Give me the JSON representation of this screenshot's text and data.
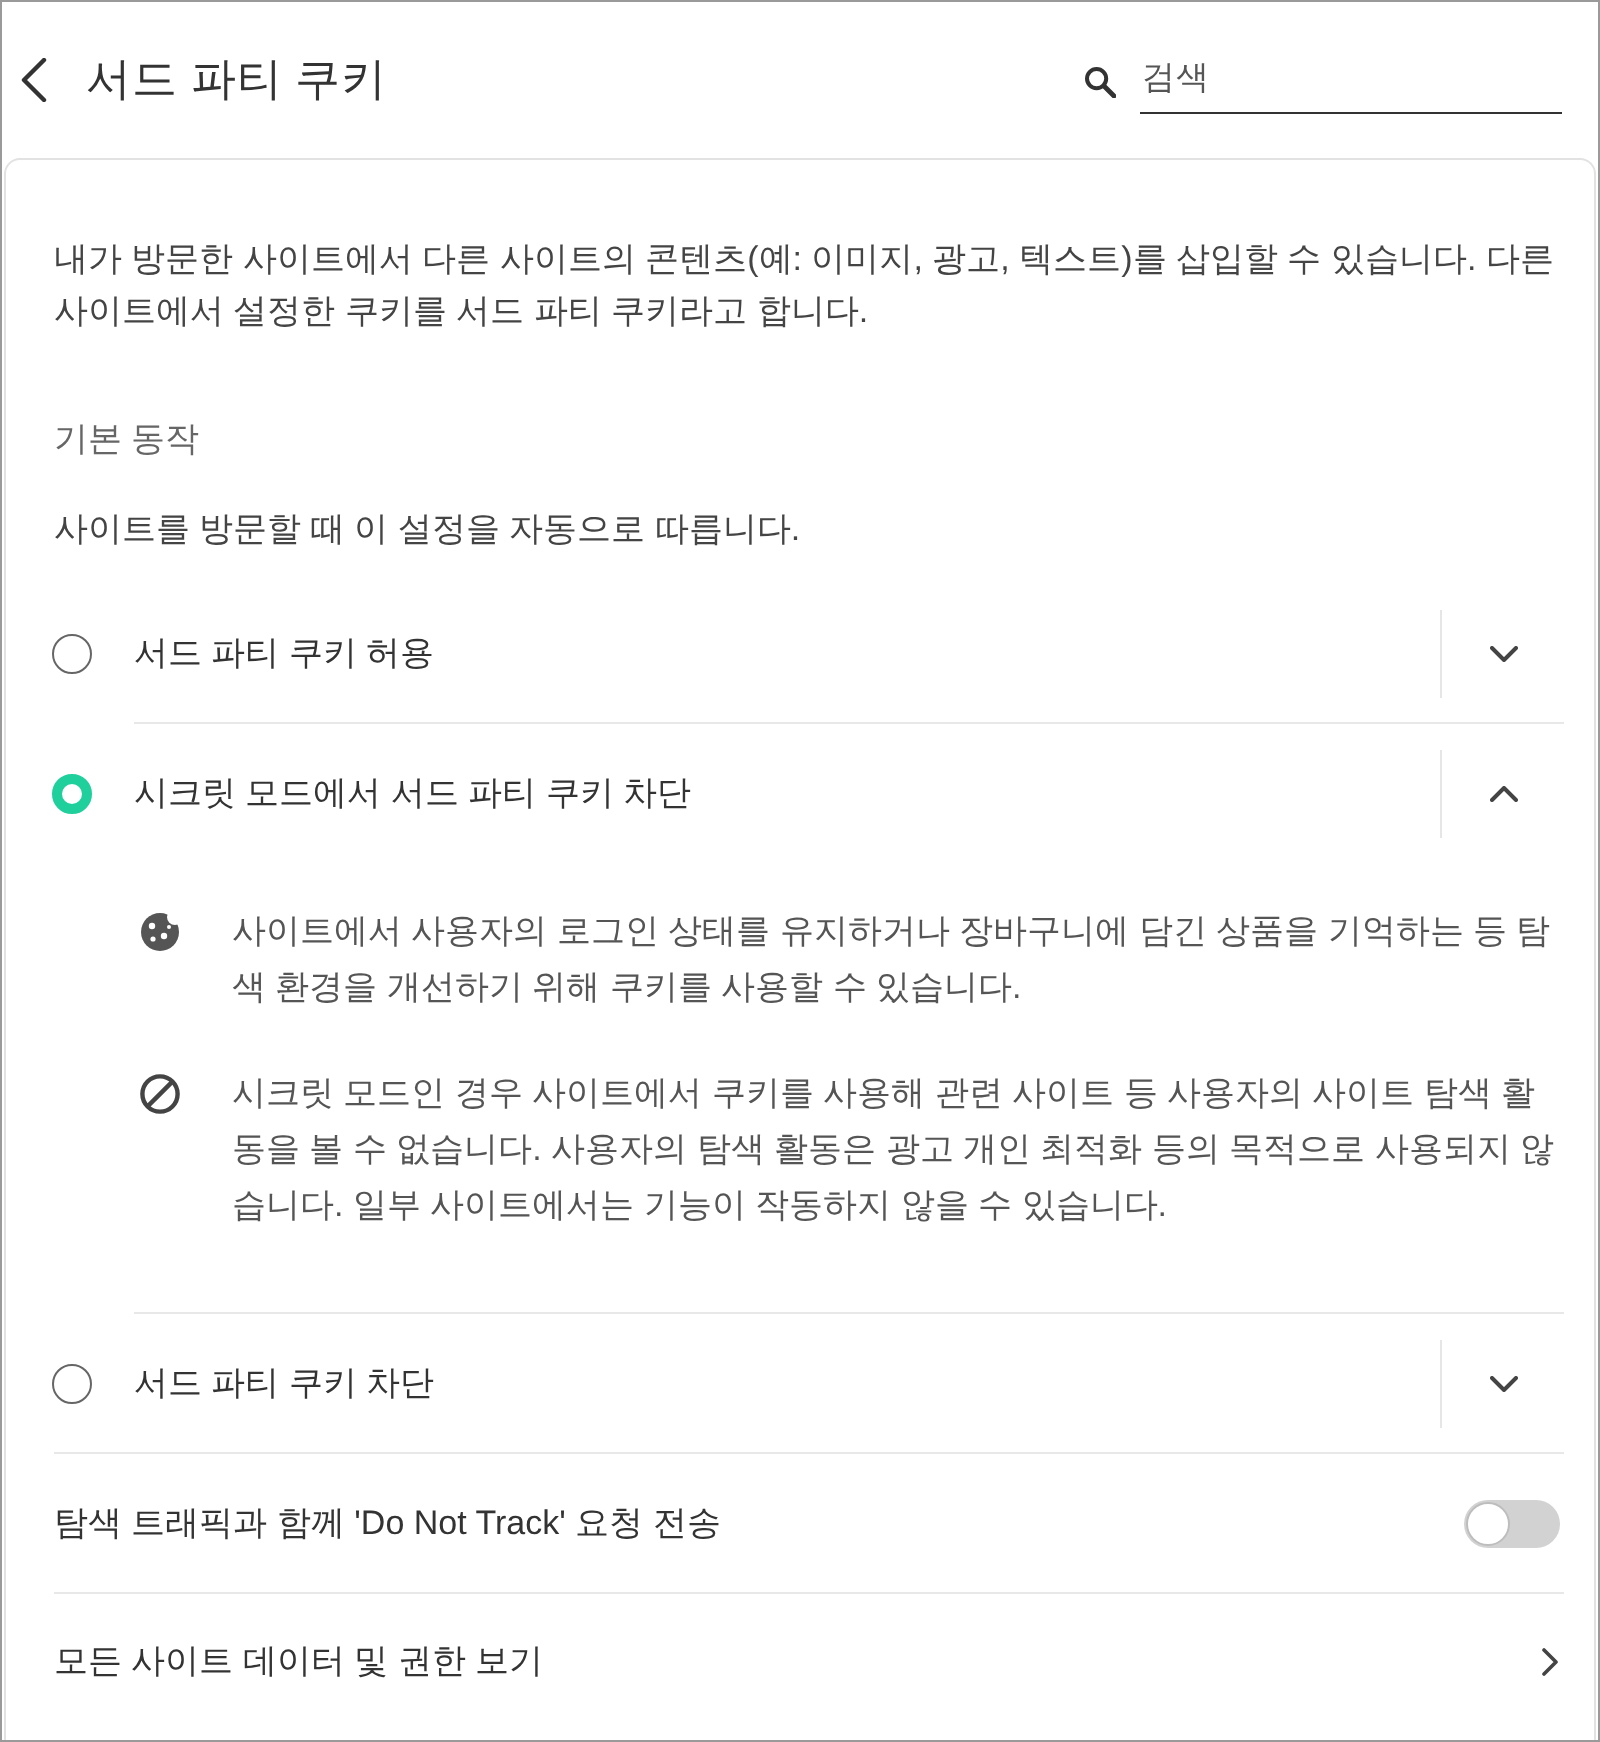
{
  "header": {
    "title": "서드 파티 쿠키",
    "search": {
      "placeholder": "검색"
    }
  },
  "intro": "내가 방문한 사이트에서 다른 사이트의 콘텐츠(예: 이미지, 광고, 텍스트)를 삽입할 수 있습니다. 다른 사이트에서 설정한 쿠키를 서드 파티 쿠키라고 합니다.",
  "default_behavior": {
    "heading": "기본 동작",
    "description": "사이트를 방문할 때 이 설정을 자동으로 따릅니다.",
    "options": [
      {
        "label": "서드 파티 쿠키 허용",
        "selected": false,
        "expanded": false
      },
      {
        "label": "시크릿 모드에서 서드 파티 쿠키 차단",
        "selected": true,
        "expanded": true,
        "details": [
          {
            "kind": "cookie",
            "text": "사이트에서 사용자의 로그인 상태를 유지하거나 장바구니에 담긴 상품을 기억하는 등 탐색 환경을 개선하기 위해 쿠키를 사용할 수 있습니다."
          },
          {
            "kind": "block",
            "text": "시크릿 모드인 경우 사이트에서 쿠키를 사용해 관련 사이트 등 사용자의 사이트 탐색 활동을 볼 수 없습니다. 사용자의 탐색 활동은 광고 개인 최적화 등의 목적으로 사용되지 않습니다. 일부 사이트에서는 기능이 작동하지 않을 수 있습니다."
          }
        ]
      },
      {
        "label": "서드 파티 쿠키 차단",
        "selected": false,
        "expanded": false
      }
    ]
  },
  "do_not_track": {
    "label": "탐색 트래픽과 함께 'Do Not Track' 요청 전송",
    "on": false
  },
  "site_data_link": {
    "label": "모든 사이트 데이터 및 권한 보기"
  }
}
